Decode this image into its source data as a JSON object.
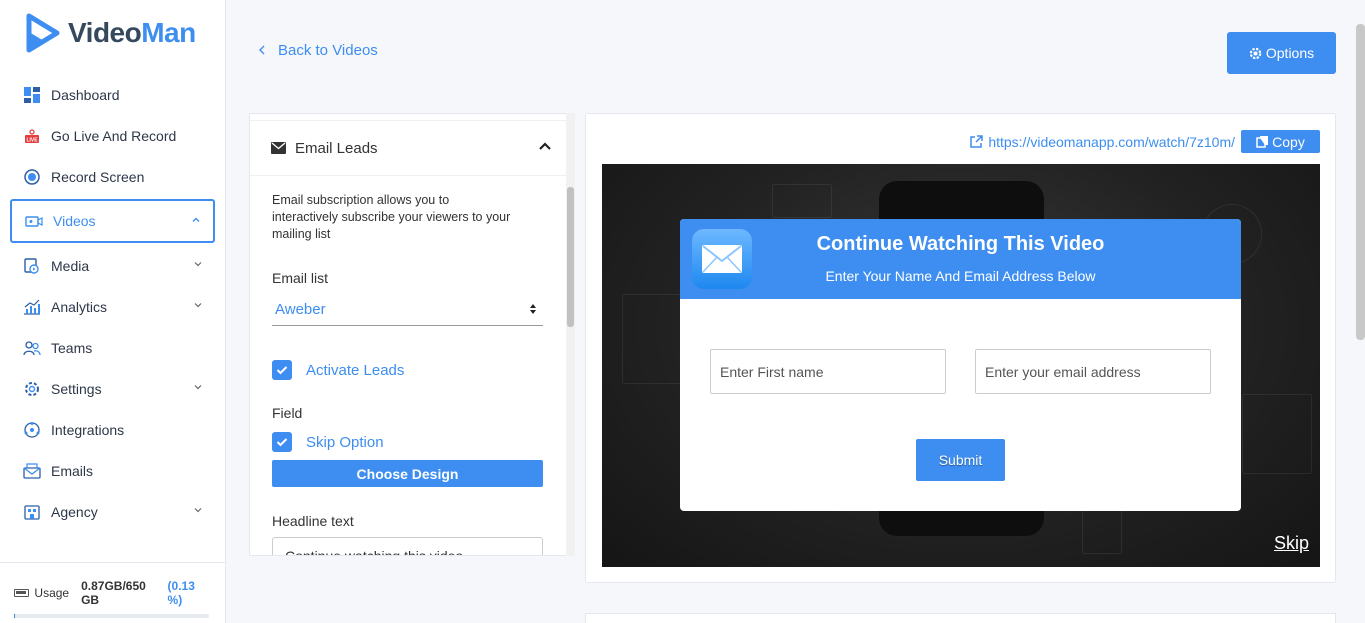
{
  "app": {
    "logo_video": "Video",
    "logo_man": "Man",
    "brand_color": "#3d8ef0"
  },
  "sidebar": {
    "items": [
      {
        "label": "Dashboard",
        "icon": "dashboard-icon"
      },
      {
        "label": "Go Live And Record",
        "icon": "live-icon"
      },
      {
        "label": "Record Screen",
        "icon": "record-icon"
      },
      {
        "label": "Videos",
        "icon": "video-icon",
        "active": true
      },
      {
        "label": "Media",
        "icon": "media-icon"
      },
      {
        "label": "Analytics",
        "icon": "analytics-icon"
      },
      {
        "label": "Teams",
        "icon": "teams-icon"
      },
      {
        "label": "Settings",
        "icon": "gear-icon"
      },
      {
        "label": "Integrations",
        "icon": "integrations-icon"
      },
      {
        "label": "Emails",
        "icon": "emails-icon"
      },
      {
        "label": "Agency",
        "icon": "agency-icon"
      }
    ],
    "usage": {
      "label": "Usage",
      "value": "0.87GB/650 GB",
      "percent": "(0.13 %)",
      "fraction": 0.0013
    }
  },
  "header": {
    "back_label": "Back to Videos",
    "options_label": "Options"
  },
  "panel": {
    "title": "Email Leads",
    "description": "Email subscription allows you to interactively subscribe your viewers to your mailing list",
    "email_list_label": "Email list",
    "email_list_value": "Aweber",
    "activate_leads_label": "Activate Leads",
    "field_label": "Field",
    "skip_option_label": "Skip Option",
    "choose_design_label": "Choose Design",
    "headline_label": "Headline text",
    "headline_value": "Continue watching this video"
  },
  "preview": {
    "url": "https://videomanapp.com/watch/7z10m/",
    "copy_label": "Copy",
    "popup_title": "Continue Watching This Video",
    "popup_subtitle": "Enter Your Name And Email Address Below",
    "first_name_placeholder": "Enter First name",
    "email_placeholder": "Enter your email address",
    "submit_label": "Submit",
    "skip_label": "Skip"
  }
}
